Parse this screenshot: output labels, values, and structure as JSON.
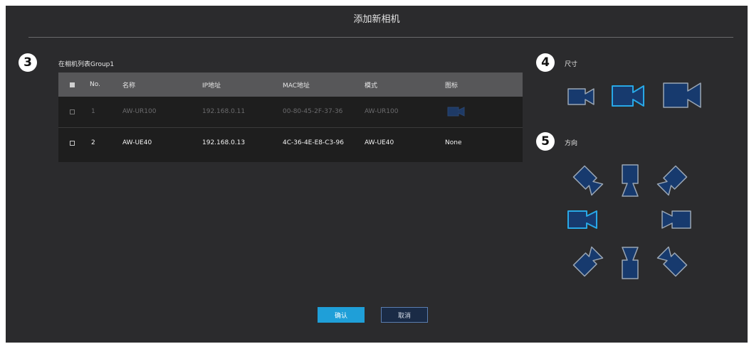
{
  "dialog": {
    "title": "添加新相机",
    "confirm_label": "确认",
    "cancel_label": "取消"
  },
  "steps": {
    "list": "3",
    "size": "4",
    "direction": "5"
  },
  "list_section": {
    "label": "在相机列表Group1"
  },
  "table": {
    "headers": {
      "no": "No.",
      "name": "名称",
      "ip": "IP地址",
      "mac": "MAC地址",
      "model": "模式",
      "icon": "图标"
    },
    "rows": [
      {
        "no": "1",
        "name": "AW-UR100",
        "ip": "192.168.0.11",
        "mac": "00-80-45-2F-37-36",
        "model": "AW-UR100",
        "icon": "camera-icon",
        "enabled": false
      },
      {
        "no": "2",
        "name": "AW-UE40",
        "ip": "192.168.0.13",
        "mac": "4C-36-4E-E8-C3-96",
        "model": "AW-UE40",
        "icon": "None",
        "enabled": true
      }
    ]
  },
  "size_section": {
    "label": "尺寸",
    "options": [
      "small",
      "medium",
      "large"
    ],
    "selected": "medium"
  },
  "direction_section": {
    "label": "方向",
    "options": [
      "up-left",
      "up",
      "up-right",
      "left",
      "right",
      "down-left",
      "down",
      "down-right"
    ],
    "selected": "left"
  },
  "colors": {
    "dialog_bg": "#2b2b2d",
    "camera_fill": "#173a6e",
    "camera_border": "#9aa6b4",
    "selected_border": "#28a8e6",
    "accent": "#1f9fd8"
  }
}
